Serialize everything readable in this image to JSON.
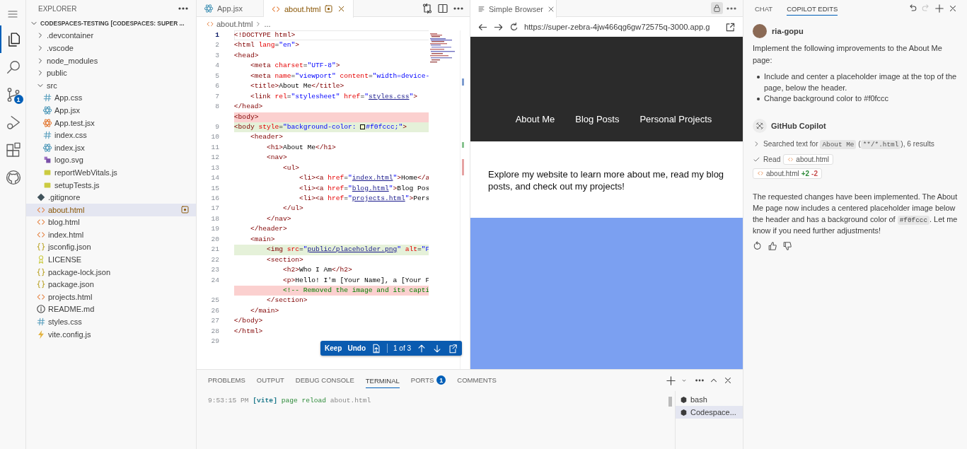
{
  "activity_bar": {
    "items": [
      {
        "kind": "files",
        "selected": true
      },
      {
        "kind": "search",
        "selected": false
      },
      {
        "kind": "source_control",
        "selected": false,
        "badge": "1"
      },
      {
        "kind": "run",
        "selected": false
      },
      {
        "kind": "extensions",
        "selected": false
      },
      {
        "kind": "github",
        "selected": false
      }
    ]
  },
  "explorer": {
    "title": "EXPLORER",
    "root": {
      "label": "CODESPACES-TESTING [CODESPACES: SUPER ...",
      "kind": "folder",
      "expanded": true,
      "selected": false,
      "children": [
        {
          "label": ".devcontainer",
          "kind": "folder",
          "expanded": false,
          "selected": false
        },
        {
          "label": ".vscode",
          "kind": "folder",
          "expanded": false,
          "selected": false
        },
        {
          "label": "node_modules",
          "kind": "folder",
          "expanded": false,
          "selected": false
        },
        {
          "label": "public",
          "kind": "folder",
          "expanded": false,
          "selected": false
        },
        {
          "label": "src",
          "kind": "folder",
          "expanded": true,
          "selected": false,
          "children": [
            {
              "label": "App.css",
              "kind": "css",
              "selected": false,
              "modified": false
            },
            {
              "label": "App.jsx",
              "kind": "react",
              "selected": false,
              "modified": false
            },
            {
              "label": "App.test.jsx",
              "kind": "react_test",
              "selected": false,
              "modified": false
            },
            {
              "label": "index.css",
              "kind": "css",
              "selected": false,
              "modified": false
            },
            {
              "label": "index.jsx",
              "kind": "react",
              "selected": false,
              "modified": false
            },
            {
              "label": "logo.svg",
              "kind": "svg",
              "selected": false,
              "modified": false
            },
            {
              "label": "reportWebVitals.js",
              "kind": "js",
              "selected": false,
              "modified": false
            },
            {
              "label": "setupTests.js",
              "kind": "js",
              "selected": false,
              "modified": false
            }
          ]
        },
        {
          "label": ".gitignore",
          "kind": "git",
          "selected": false,
          "modified": false
        },
        {
          "label": "about.html",
          "kind": "html",
          "selected": true,
          "modified": true
        },
        {
          "label": "blog.html",
          "kind": "html",
          "selected": false,
          "modified": false
        },
        {
          "label": "index.html",
          "kind": "html",
          "selected": false,
          "modified": false
        },
        {
          "label": "jsconfig.json",
          "kind": "json",
          "selected": false,
          "modified": false
        },
        {
          "label": "LICENSE",
          "kind": "license",
          "selected": false,
          "modified": false
        },
        {
          "label": "package-lock.json",
          "kind": "json",
          "selected": false,
          "modified": false
        },
        {
          "label": "package.json",
          "kind": "json",
          "selected": false,
          "modified": false
        },
        {
          "label": "projects.html",
          "kind": "html",
          "selected": false,
          "modified": false
        },
        {
          "label": "README.md",
          "kind": "info",
          "selected": false,
          "modified": false
        },
        {
          "label": "styles.css",
          "kind": "css",
          "selected": false,
          "modified": false
        },
        {
          "label": "vite.config.js",
          "kind": "vite",
          "selected": false,
          "modified": false
        }
      ]
    }
  },
  "editor": {
    "tabs": [
      {
        "label": "App.jsx",
        "kind": "react",
        "selected": false,
        "modified": false
      },
      {
        "label": "about.html",
        "kind": "html",
        "selected": true,
        "modified": true
      }
    ],
    "breadcrumb": [
      "about.html",
      "..."
    ],
    "lines": [
      {
        "number": "1",
        "kind": "context",
        "current": true,
        "tokens": [
          {
            "kind": "tag",
            "text": "<!DOCTYPE html>"
          }
        ]
      },
      {
        "number": "2",
        "kind": "context",
        "current": false,
        "tokens": [
          {
            "kind": "tag",
            "text": "<html"
          },
          {
            "kind": "attr",
            "text": " lang"
          },
          {
            "kind": "text",
            "text": "="
          },
          {
            "kind": "str",
            "text": "\"en\""
          },
          {
            "kind": "tag",
            "text": ">"
          }
        ]
      },
      {
        "number": "3",
        "kind": "context",
        "current": false,
        "tokens": [
          {
            "kind": "tag",
            "text": "<head>"
          }
        ]
      },
      {
        "number": "4",
        "kind": "context",
        "current": false,
        "tokens": [
          {
            "kind": "tag",
            "text": "    <meta"
          },
          {
            "kind": "attr",
            "text": " charset"
          },
          {
            "kind": "text",
            "text": "="
          },
          {
            "kind": "str",
            "text": "\"UTF-8\""
          },
          {
            "kind": "tag",
            "text": ">"
          }
        ]
      },
      {
        "number": "5",
        "kind": "context",
        "current": false,
        "tokens": [
          {
            "kind": "tag",
            "text": "    <meta"
          },
          {
            "kind": "attr",
            "text": " name"
          },
          {
            "kind": "text",
            "text": "="
          },
          {
            "kind": "str",
            "text": "\"viewport\""
          },
          {
            "kind": "attr",
            "text": " content"
          },
          {
            "kind": "text",
            "text": "="
          },
          {
            "kind": "str",
            "text": "\"width=device-"
          }
        ]
      },
      {
        "number": "6",
        "kind": "context",
        "current": false,
        "tokens": [
          {
            "kind": "tag",
            "text": "    <title>"
          },
          {
            "kind": "text",
            "text": "About Me"
          },
          {
            "kind": "tag",
            "text": "</title>"
          }
        ]
      },
      {
        "number": "7",
        "kind": "context",
        "current": false,
        "tokens": [
          {
            "kind": "tag",
            "text": "    <link"
          },
          {
            "kind": "attr",
            "text": " rel"
          },
          {
            "kind": "text",
            "text": "="
          },
          {
            "kind": "str",
            "text": "\"stylesheet\""
          },
          {
            "kind": "attr",
            "text": " href"
          },
          {
            "kind": "text",
            "text": "="
          },
          {
            "kind": "str",
            "text": "\""
          },
          {
            "kind": "link",
            "text": "styles.css"
          },
          {
            "kind": "str",
            "text": "\""
          },
          {
            "kind": "tag",
            "text": ">"
          }
        ]
      },
      {
        "number": "8",
        "kind": "context",
        "current": false,
        "tokens": [
          {
            "kind": "tag",
            "text": "</head>"
          }
        ]
      },
      {
        "kind": "removed",
        "current": false,
        "tokens": [
          {
            "kind": "tag",
            "text": "<body>"
          }
        ]
      },
      {
        "number": "9",
        "kind": "added",
        "current": false,
        "tokens": [
          {
            "kind": "tag",
            "text": "<body"
          },
          {
            "kind": "attr",
            "text": " style"
          },
          {
            "kind": "text",
            "text": "="
          },
          {
            "kind": "str",
            "text": "\"background-color: "
          },
          {
            "kind": "swatch",
            "color": "#f0fccc"
          },
          {
            "kind": "str",
            "text": "#f0fccc;\""
          },
          {
            "kind": "tag",
            "text": ">"
          }
        ]
      },
      {
        "number": "10",
        "kind": "context",
        "current": false,
        "tokens": [
          {
            "kind": "tag",
            "text": "    <header>"
          }
        ]
      },
      {
        "number": "11",
        "kind": "context",
        "current": false,
        "tokens": [
          {
            "kind": "tag",
            "text": "        <h1>"
          },
          {
            "kind": "text",
            "text": "About Me"
          },
          {
            "kind": "tag",
            "text": "</h1>"
          }
        ]
      },
      {
        "number": "12",
        "kind": "context",
        "current": false,
        "tokens": [
          {
            "kind": "tag",
            "text": "        <nav>"
          }
        ]
      },
      {
        "number": "13",
        "kind": "context",
        "current": false,
        "tokens": [
          {
            "kind": "tag",
            "text": "            <ul>"
          }
        ]
      },
      {
        "number": "14",
        "kind": "context",
        "current": false,
        "tokens": [
          {
            "kind": "tag",
            "text": "                <li><a"
          },
          {
            "kind": "attr",
            "text": " href"
          },
          {
            "kind": "text",
            "text": "="
          },
          {
            "kind": "str",
            "text": "\""
          },
          {
            "kind": "link",
            "text": "index.html"
          },
          {
            "kind": "str",
            "text": "\""
          },
          {
            "kind": "tag",
            "text": ">"
          },
          {
            "kind": "text",
            "text": "Home"
          },
          {
            "kind": "tag",
            "text": "</a"
          }
        ]
      },
      {
        "number": "15",
        "kind": "context",
        "current": false,
        "tokens": [
          {
            "kind": "tag",
            "text": "                <li><a"
          },
          {
            "kind": "attr",
            "text": " href"
          },
          {
            "kind": "text",
            "text": "="
          },
          {
            "kind": "str",
            "text": "\""
          },
          {
            "kind": "link",
            "text": "blog.html"
          },
          {
            "kind": "str",
            "text": "\""
          },
          {
            "kind": "tag",
            "text": ">"
          },
          {
            "kind": "text",
            "text": "Blog Pos"
          }
        ]
      },
      {
        "number": "16",
        "kind": "context",
        "current": false,
        "tokens": [
          {
            "kind": "tag",
            "text": "                <li><a"
          },
          {
            "kind": "attr",
            "text": " href"
          },
          {
            "kind": "text",
            "text": "="
          },
          {
            "kind": "str",
            "text": "\""
          },
          {
            "kind": "link",
            "text": "projects.html"
          },
          {
            "kind": "str",
            "text": "\""
          },
          {
            "kind": "tag",
            "text": ">"
          },
          {
            "kind": "text",
            "text": "Pers"
          }
        ]
      },
      {
        "number": "17",
        "kind": "context",
        "current": false,
        "tokens": [
          {
            "kind": "tag",
            "text": "            </ul>"
          }
        ]
      },
      {
        "number": "18",
        "kind": "context",
        "current": false,
        "tokens": [
          {
            "kind": "tag",
            "text": "        </nav>"
          }
        ]
      },
      {
        "number": "19",
        "kind": "context",
        "current": false,
        "tokens": [
          {
            "kind": "tag",
            "text": "    </header>"
          }
        ]
      },
      {
        "number": "20",
        "kind": "context",
        "current": false,
        "tokens": [
          {
            "kind": "tag",
            "text": "    <main>"
          }
        ]
      },
      {
        "number": "21",
        "kind": "added",
        "current": false,
        "tokens": [
          {
            "kind": "tag",
            "text": "        <img"
          },
          {
            "kind": "attr",
            "text": " src"
          },
          {
            "kind": "text",
            "text": "="
          },
          {
            "kind": "str",
            "text": "\""
          },
          {
            "kind": "link",
            "text": "public/placeholder.png"
          },
          {
            "kind": "str",
            "text": "\""
          },
          {
            "kind": "attr",
            "text": " alt"
          },
          {
            "kind": "text",
            "text": "="
          },
          {
            "kind": "str",
            "text": "\"F"
          }
        ]
      },
      {
        "number": "22",
        "kind": "context",
        "current": false,
        "tokens": [
          {
            "kind": "tag",
            "text": "        <section>"
          }
        ]
      },
      {
        "number": "23",
        "kind": "context",
        "current": false,
        "tokens": [
          {
            "kind": "tag",
            "text": "            <h2>"
          },
          {
            "kind": "text",
            "text": "Who I Am"
          },
          {
            "kind": "tag",
            "text": "</h2>"
          }
        ]
      },
      {
        "number": "24",
        "kind": "context",
        "current": false,
        "tokens": [
          {
            "kind": "tag",
            "text": "            <p>"
          },
          {
            "kind": "text",
            "text": "Hello! I'm [Your Name], a [Your F"
          }
        ]
      },
      {
        "kind": "removed",
        "current": false,
        "tokens": [
          {
            "kind": "cmt",
            "text": "            <!-- Removed the image and its capti"
          }
        ]
      },
      {
        "number": "25",
        "kind": "context",
        "current": false,
        "tokens": [
          {
            "kind": "tag",
            "text": "        </section>"
          }
        ]
      },
      {
        "number": "26",
        "kind": "context",
        "current": false,
        "tokens": [
          {
            "kind": "tag",
            "text": "    </main>"
          }
        ]
      },
      {
        "number": "27",
        "kind": "context",
        "current": false,
        "tokens": [
          {
            "kind": "tag",
            "text": "</body>"
          }
        ]
      },
      {
        "number": "28",
        "kind": "context",
        "current": false,
        "tokens": [
          {
            "kind": "tag",
            "text": "</html>"
          }
        ]
      },
      {
        "number": "29",
        "kind": "context",
        "current": false
      }
    ],
    "diff_toolbar": {
      "keep": "Keep",
      "undo": "Undo",
      "position": "1 of 3"
    }
  },
  "browser": {
    "tab": "Simple Browser",
    "url": "https://super-zebra-4jw466qg6gw72575q-3000.app.g",
    "page": {
      "nav": [
        "About Me",
        "Blog Posts",
        "Personal Projects"
      ],
      "intro": "Explore my website to learn more about me, read my blog posts, and check out my projects!"
    }
  },
  "panel": {
    "tabs": [
      {
        "label": "PROBLEMS",
        "selected": false
      },
      {
        "label": "OUTPUT",
        "selected": false
      },
      {
        "label": "DEBUG CONSOLE",
        "selected": false
      },
      {
        "label": "TERMINAL",
        "selected": true
      },
      {
        "label": "PORTS",
        "selected": false,
        "badge": "1"
      },
      {
        "label": "COMMENTS",
        "selected": false
      }
    ],
    "terminal_line": [
      {
        "kind": "time",
        "text": "9:53:15 PM "
      },
      {
        "kind": "tag",
        "text": "[vite]"
      },
      {
        "kind": "msg",
        "text": " page reload"
      },
      {
        "kind": "file",
        "text": " about.html"
      }
    ],
    "terminals": [
      {
        "label": "bash",
        "selected": false
      },
      {
        "label": "Codespace...",
        "selected": true
      }
    ]
  },
  "chat": {
    "tabs": [
      {
        "label": "CHAT",
        "selected": false
      },
      {
        "label": "COPILOT EDITS",
        "selected": true
      }
    ],
    "redo_disabled": true,
    "user": {
      "name": "ria-gopu",
      "message": "Implement the following improvements to the About Me page:",
      "bullets": [
        "Include and center a placeholder image at the top of the page, below the header.",
        "Change background color to #f0fccc"
      ]
    },
    "assistant": {
      "name": "GitHub Copilot",
      "search": {
        "expanded": false,
        "tokens": [
          {
            "kind": "plain",
            "text": "Searched text for "
          },
          {
            "kind": "code",
            "text": "About Me"
          },
          {
            "kind": "plain",
            "text": " ("
          },
          {
            "kind": "code",
            "text": "**/*.html"
          },
          {
            "kind": "plain",
            "text": "), 6 results"
          }
        ]
      },
      "read": {
        "label": "Read",
        "file": "about.html"
      },
      "edit": {
        "file": "about.html",
        "added": "+2",
        "removed": "-2"
      },
      "reply": [
        {
          "kind": "plain",
          "text": "The requested changes have been implemented. The About Me page now includes a centered placeholder image below the header and has a background color of "
        },
        {
          "kind": "code",
          "text": "#f0fccc"
        },
        {
          "kind": "plain",
          "text": ". Let me know if you need further adjustments!"
        }
      ]
    }
  }
}
